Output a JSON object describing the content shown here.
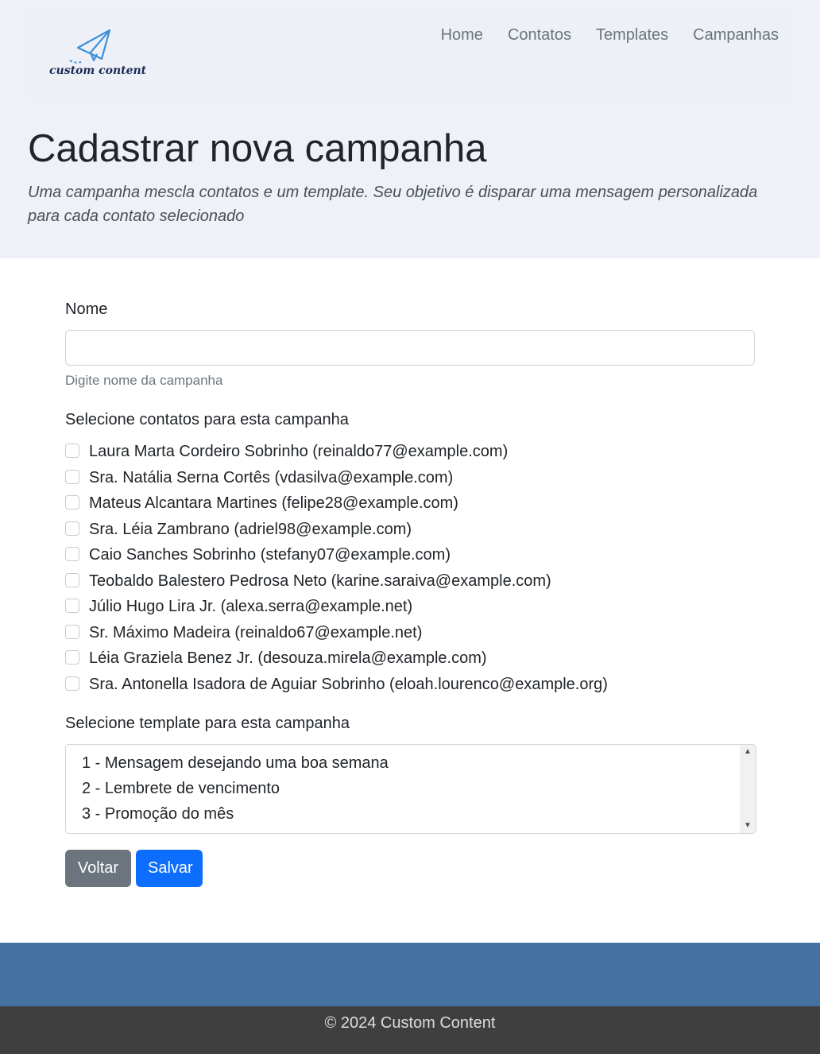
{
  "brand": {
    "logo_text": "custom content"
  },
  "nav": {
    "links": [
      "Home",
      "Contatos",
      "Templates",
      "Campanhas"
    ]
  },
  "header": {
    "title": "Cadastrar nova campanha",
    "lead": "Uma campanha mescla contatos e um template. Seu objetivo é disparar uma mensagem personalizada para cada contato selecionado"
  },
  "form": {
    "nome_label": "Nome",
    "nome_value": "",
    "nome_help": "Digite nome da campanha",
    "contatos_label": "Selecione contatos para esta campanha",
    "contacts": [
      "Laura Marta Cordeiro Sobrinho (reinaldo77@example.com)",
      "Sra. Natália Serna Cortês (vdasilva@example.com)",
      "Mateus Alcantara Martines (felipe28@example.com)",
      "Sra. Léia Zambrano (adriel98@example.com)",
      "Caio Sanches Sobrinho (stefany07@example.com)",
      "Teobaldo Balestero Pedrosa Neto (karine.saraiva@example.com)",
      "Júlio Hugo Lira Jr. (alexa.serra@example.net)",
      "Sr. Máximo Madeira (reinaldo67@example.net)",
      "Léia Graziela Benez Jr. (desouza.mirela@example.com)",
      "Sra. Antonella Isadora de Aguiar Sobrinho (eloah.lourenco@example.org)"
    ],
    "template_label": "Selecione template para esta campanha",
    "templates": [
      "1 - Mensagem desejando uma boa semana",
      "2 - Lembrete de vencimento",
      "3 - Promoção do mês"
    ],
    "voltar_label": "Voltar",
    "salvar_label": "Salvar"
  },
  "footer": {
    "copyright": "© 2024 Custom Content"
  },
  "colors": {
    "hero_bg": "#eef1f8",
    "primary": "#0d6efd",
    "secondary": "#6c757d",
    "footer_top": "#4471a2",
    "footer_bottom": "#3f3f3f"
  }
}
